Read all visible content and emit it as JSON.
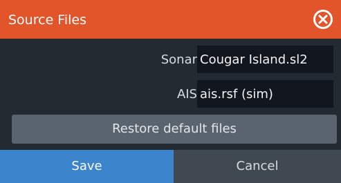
{
  "dialog": {
    "title": "Source Files",
    "close_icon": "close-circle-icon"
  },
  "fields": {
    "sonar": {
      "label": "Sonar",
      "value": "Cougar Island.sl2"
    },
    "ais": {
      "label": "AIS",
      "value": "ais.rsf (sim)"
    }
  },
  "actions": {
    "restore_label": "Restore default files",
    "save_label": "Save",
    "cancel_label": "Cancel"
  },
  "colors": {
    "title_bar": "#e2542a",
    "background": "#232a32",
    "field_background": "#11171d",
    "restore_button": "#59646f",
    "save_button": "#3c84cb",
    "cancel_button": "#404951"
  }
}
